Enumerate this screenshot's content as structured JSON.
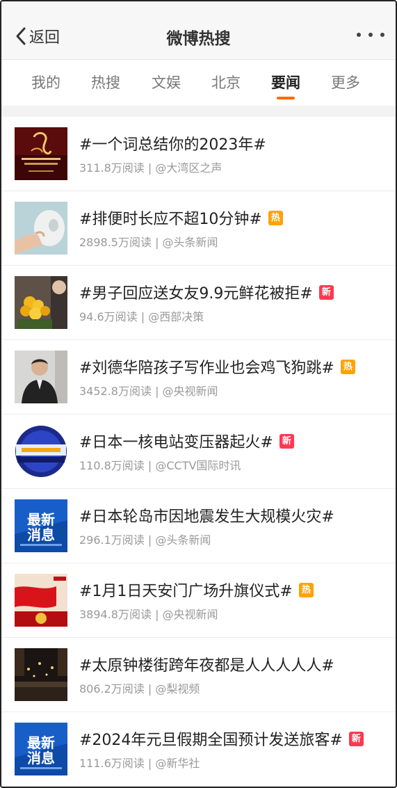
{
  "nav": {
    "back_label": "返回",
    "title": "微博热搜",
    "back_icon": "chevron-left-icon",
    "more_icon": "more-dots-icon"
  },
  "tabs": [
    {
      "label": "我的",
      "active": false
    },
    {
      "label": "热搜",
      "active": false
    },
    {
      "label": "文娱",
      "active": false
    },
    {
      "label": "北京",
      "active": false
    },
    {
      "label": "要闻",
      "active": true
    },
    {
      "label": "更多",
      "active": false
    }
  ],
  "colors": {
    "accent": "#ff6a00",
    "badge_hot": "#ffa200",
    "badge_new": "#ff3852",
    "meta_text": "#999999"
  },
  "items": [
    {
      "title": "#一个词总结你的2023年#",
      "badge": "",
      "meta": "311.8万阅读 | @大湾区之声",
      "thumb_text": "",
      "thumb_icon": "gala-poster-thumbnail"
    },
    {
      "title": "#排便时长应不超10分钟#",
      "badge": "热",
      "meta": "2898.5万阅读 | @头条新闻",
      "thumb_text": "",
      "thumb_icon": "toilet-paper-thumbnail"
    },
    {
      "title": "#男子回应送女友9.9元鲜花被拒#",
      "badge": "新",
      "meta": "94.6万阅读 | @西部决策",
      "thumb_text": "",
      "thumb_icon": "flowers-thumbnail"
    },
    {
      "title": "#刘德华陪孩子写作业也会鸡飞狗跳#",
      "badge": "热",
      "meta": "3452.8万阅读 | @央视新闻",
      "thumb_text": "",
      "thumb_icon": "man-portrait-thumbnail"
    },
    {
      "title": "#日本一核电站变压器起火#",
      "badge": "新",
      "meta": "110.8万阅读 | @CCTV国际时讯",
      "thumb_text": "",
      "thumb_icon": "world-express-logo-thumbnail"
    },
    {
      "title": "#日本轮岛市因地震发生大规模火灾#",
      "badge": "",
      "meta": "296.1万阅读 | @头条新闻",
      "thumb_text": "最新消息",
      "thumb_icon": "latest-news-thumbnail"
    },
    {
      "title": "#1月1日天安门广场升旗仪式#",
      "badge": "热",
      "meta": "3894.8万阅读 | @央视新闻",
      "thumb_text": "",
      "thumb_icon": "flag-ceremony-thumbnail"
    },
    {
      "title": "#太原钟楼街跨年夜都是人人人人人#",
      "badge": "",
      "meta": "806.2万阅读 | @梨视频",
      "thumb_text": "",
      "thumb_icon": "night-crowd-thumbnail"
    },
    {
      "title": "#2024年元旦假期全国预计发送旅客#",
      "badge": "新",
      "meta": "111.6万阅读 | @新华社",
      "thumb_text": "最新消息",
      "thumb_icon": "latest-news-thumbnail"
    }
  ]
}
